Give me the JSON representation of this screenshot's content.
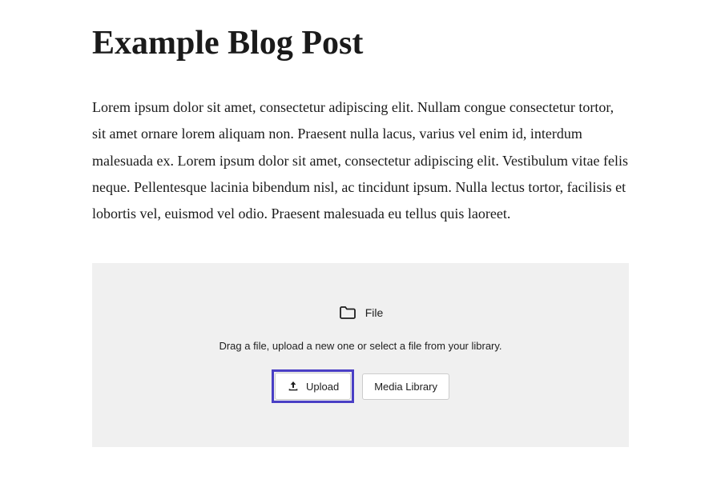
{
  "post": {
    "title": "Example Blog Post",
    "body": "Lorem ipsum dolor sit amet, consectetur adipiscing elit. Nullam congue consectetur tortor, sit amet ornare lorem aliquam non. Praesent nulla lacus, varius vel enim id, interdum malesuada ex. Lorem ipsum dolor sit amet, consectetur adipiscing elit. Vestibulum vitae felis neque.  Pellentesque lacinia bibendum nisl, ac tincidunt ipsum. Nulla lectus  tortor, facilisis et lobortis vel, euismod vel odio. Praesent malesuada  eu tellus quis laoreet."
  },
  "file_block": {
    "header_label": "File",
    "instructions": "Drag a file, upload a new one or select a file from your library.",
    "upload_label": "Upload",
    "media_library_label": "Media Library"
  },
  "colors": {
    "highlight": "#4a3fc5",
    "placeholder_bg": "#f0f0f0"
  }
}
